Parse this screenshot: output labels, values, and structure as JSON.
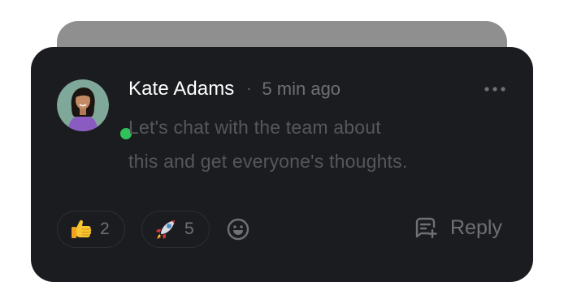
{
  "comment": {
    "author": "Kate Adams",
    "separator": "·",
    "time": "5 min ago",
    "message_lines": [
      "Let's chat with the team about",
      "this and get everyone's thoughts."
    ],
    "online_status_color": "#2fc25b",
    "icons": {
      "more": "more-horizontal-icon",
      "add_reaction": "smiley-icon",
      "reply": "reply-message-icon"
    }
  },
  "reactions": [
    {
      "emoji": "thumbs-up",
      "count": "2"
    },
    {
      "emoji": "rocket",
      "count": "5"
    }
  ],
  "actions": {
    "reply_label": "Reply"
  }
}
